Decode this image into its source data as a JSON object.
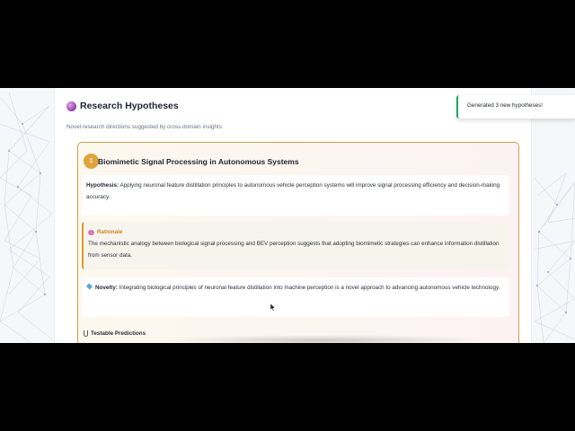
{
  "page": {
    "title": "Research Hypotheses",
    "subtitle": "Novel research directions suggested by cross-domain insights"
  },
  "toast": {
    "message": "Generated 3 new hypotheses!"
  },
  "hypothesis_card": {
    "number": "1",
    "title": "Biomimetic Signal Processing in Autonomous Systems",
    "hypothesis_label": "Hypothesis:",
    "hypothesis_text": "Applying neuronal feature distillation principles to autonomous vehicle perception systems will improve signal processing efficiency and decision-making accuracy.",
    "rationale_label": "Rationale",
    "rationale_text": "The mechanistic analogy between biological signal processing and BEV perception suggests that adopting biomimetic strategies can enhance information distillation from sensor data.",
    "novelty_label": "Novelty:",
    "novelty_text": "Integrating biological principles of neuronal feature distillation into machine perception is a novel approach to advancing autonomous vehicle technology.",
    "predictions_label": "Testable Predictions"
  },
  "colors": {
    "accent_gold": "#e0a23a",
    "rationale_gold": "#c98a1e",
    "toast_green": "#22a06b"
  },
  "icons": {
    "title_icon": "brain-icon",
    "rationale_icon": "brain-icon",
    "novelty_icon": "gem-icon",
    "predictions_icon": "flask-icon"
  }
}
